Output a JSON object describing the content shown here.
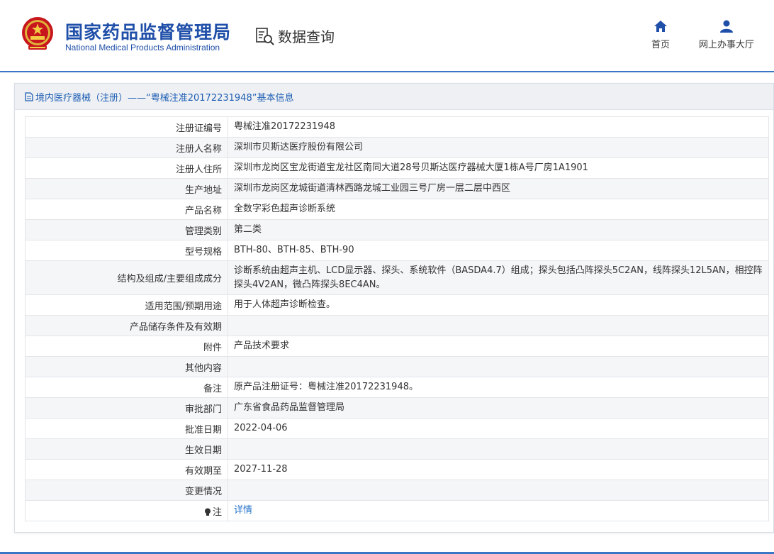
{
  "header": {
    "org_name_cn": "国家药品监督管理局",
    "org_name_en": "National Medical Products Administration",
    "query_label": "数据查询",
    "nav": [
      {
        "label": "首页",
        "icon": "home-icon"
      },
      {
        "label": "网上办事大厅",
        "icon": "user-icon"
      }
    ]
  },
  "panel": {
    "title": "境内医疗器械（注册）——“粤械注准20172231948”基本信息"
  },
  "rows": [
    {
      "label": "注册证编号",
      "value": "粤械注准20172231948"
    },
    {
      "label": "注册人名称",
      "value": "深圳市贝斯达医疗股份有限公司"
    },
    {
      "label": "注册人住所",
      "value": "深圳市龙岗区宝龙街道宝龙社区南同大道28号贝斯达医疗器械大厦1栋A号厂房1A1901"
    },
    {
      "label": "生产地址",
      "value": "深圳市龙岗区龙城街道清林西路龙城工业园三号厂房一层二层中西区"
    },
    {
      "label": "产品名称",
      "value": "全数字彩色超声诊断系统"
    },
    {
      "label": "管理类别",
      "value": "第二类"
    },
    {
      "label": "型号规格",
      "value": "BTH-80、BTH-85、BTH-90"
    },
    {
      "label": "结构及组成/主要组成成分",
      "value": "诊断系统由超声主机、LCD显示器、探头、系统软件（BASDA4.7）组成；探头包括凸阵探头5C2AN，线阵探头12L5AN，相控阵探头4V2AN，微凸阵探头8EC4AN。"
    },
    {
      "label": "适用范围/预期用途",
      "value": "用于人体超声诊断检查。"
    },
    {
      "label": "产品储存条件及有效期",
      "value": ""
    },
    {
      "label": "附件",
      "value": "产品技术要求"
    },
    {
      "label": "其他内容",
      "value": ""
    },
    {
      "label": "备注",
      "value": "原产品注册证号：粤械注准20172231948。"
    },
    {
      "label": "审批部门",
      "value": "广东省食品药品监督管理局"
    },
    {
      "label": "批准日期",
      "value": "2022-04-06"
    },
    {
      "label": "生效日期",
      "value": ""
    },
    {
      "label": "有效期至",
      "value": "2027-11-28"
    },
    {
      "label": "变更情况",
      "value": ""
    },
    {
      "label": "注",
      "value": "详情"
    }
  ],
  "colors": {
    "brand_blue": "#1f4fa8",
    "link_blue": "#1f6fc8",
    "accent_line": "#3a76c6"
  }
}
